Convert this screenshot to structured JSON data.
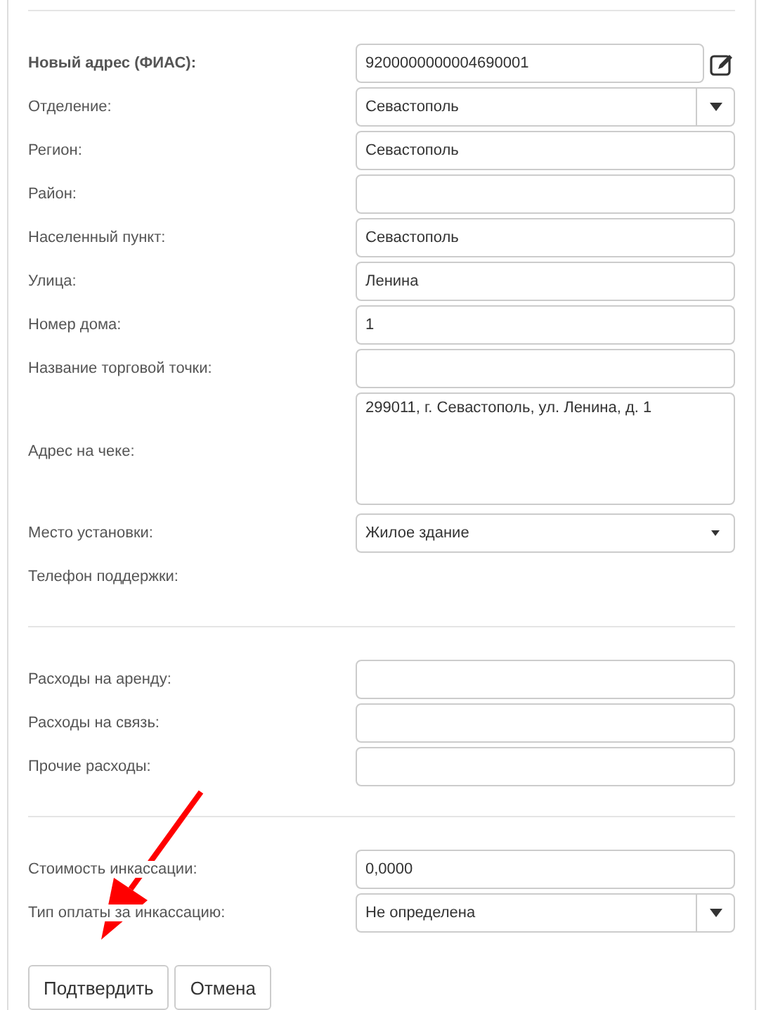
{
  "sections": [
    {
      "rows": [
        {
          "label": "Новый адрес (ФИАС):",
          "bold": true,
          "kind": "text",
          "value": "9200000000004690001",
          "editable": true
        },
        {
          "label": "Отделение:",
          "kind": "select",
          "value": "Севастополь"
        },
        {
          "label": "Регион:",
          "kind": "text",
          "value": "Севастополь"
        },
        {
          "label": "Район:",
          "kind": "text"
        },
        {
          "label": "Населенный пункт:",
          "kind": "text",
          "value": "Севастополь"
        },
        {
          "label": "Улица:",
          "kind": "text",
          "value": "Ленина"
        },
        {
          "label": "Номер дома:",
          "kind": "text",
          "value": "1"
        },
        {
          "label": "Название торговой точки:",
          "kind": "text"
        },
        {
          "label": "Адрес на чеке:",
          "kind": "textarea",
          "value": "299011, г. Севастополь, ул. Ленина, д. 1"
        },
        {
          "label": "Место установки:",
          "kind": "dropdown",
          "value": "Жилое здание"
        },
        {
          "label": "Телефон поддержки:",
          "kind": "none"
        }
      ]
    },
    {
      "rows": [
        {
          "label": "Расходы на аренду:",
          "kind": "text"
        },
        {
          "label": "Расходы на связь:",
          "kind": "text"
        },
        {
          "label": "Прочие расходы:",
          "kind": "text"
        }
      ]
    },
    {
      "rows": [
        {
          "label": "Стоимость инкассации:",
          "kind": "text",
          "value": "0,0000"
        },
        {
          "label": "Тип оплаты за инкассацию:",
          "kind": "select",
          "value": "Не определена"
        }
      ]
    }
  ],
  "buttons": [
    "Подтвердить",
    "Отмена"
  ]
}
